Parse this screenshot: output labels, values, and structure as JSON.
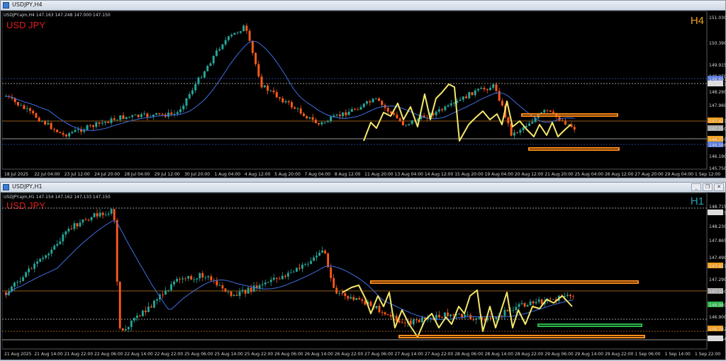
{
  "top": {
    "title": "USDJPY,H4",
    "info": "USDJPY.ajm,H4  147.163 147.248 147.000 147.150",
    "pair": "USD JPY",
    "timeframe": "H4",
    "tf_color": "#f0a020",
    "price_labels": [
      "151.030",
      "150.390",
      "149.915",
      "149.270",
      "148.891",
      "148.711",
      "148.290",
      "147.960",
      "147.421",
      "147.150",
      "146.750",
      "146.566",
      "146.190",
      "145.750"
    ],
    "date_labels": [
      "18 Jul 2025",
      "22 Jul 04:00",
      "23 Jul 12:00",
      "24 Jul 20:00",
      "28 Jul 04:00",
      "29 Jul 12:00",
      "30 Jul 20:00",
      "1 Aug 04:00",
      "4 Aug 12:00",
      "5 Aug 20:00",
      "7 Aug 04:00",
      "8 Aug 12:00",
      "11 Aug 20:00",
      "13 Aug 04:00",
      "14 Aug 12:00",
      "15 Aug 20:00",
      "19 Aug 04:00",
      "20 Aug 12:00",
      "21 Aug 20:00",
      "25 Aug 04:00",
      "26 Aug 12:00",
      "27 Aug 20:00",
      "29 Aug 04:00",
      "1 Sep 12:00"
    ]
  },
  "bottom": {
    "title": "USDJPY,H1",
    "info": "USDJPY.ajm,H1  147.154 147.162 147.133 147.150",
    "pair": "USD JPY",
    "timeframe": "H1",
    "tf_color": "#27a0b0",
    "price_labels": [
      "148.715",
      "148.625",
      "148.230",
      "147.865",
      "147.490",
      "147.421",
      "147.290",
      "147.150",
      "146.960",
      "146.900",
      "146.782",
      "146.664"
    ],
    "date_labels": [
      "21 Aug 2025",
      "21 Aug 14:00",
      "21 Aug 22:00",
      "22 Aug 06:00",
      "22 Aug 14:00",
      "22 Aug 22:00",
      "25 Aug 06:00",
      "25 Aug 14:00",
      "25 Aug 22:00",
      "26 Aug 06:00",
      "26 Aug 14:00",
      "26 Aug 22:00",
      "27 Aug 06:00",
      "27 Aug 14:00",
      "27 Aug 22:00",
      "28 Aug 06:00",
      "28 Aug 14:00",
      "28 Aug 22:00",
      "29 Aug 06:00",
      "29 Aug 14:00",
      "29 Aug 22:00",
      "1 Sep 06:00",
      "1 Sep 14:00",
      "1 Sep 22:00"
    ]
  },
  "colors": {
    "bull": "#26a69a",
    "bear": "#ff5a1a",
    "ma": "#3f6fe0",
    "zigzag": "#f5e86a",
    "box": "#ff8c1a",
    "support": "#2db84a"
  }
}
